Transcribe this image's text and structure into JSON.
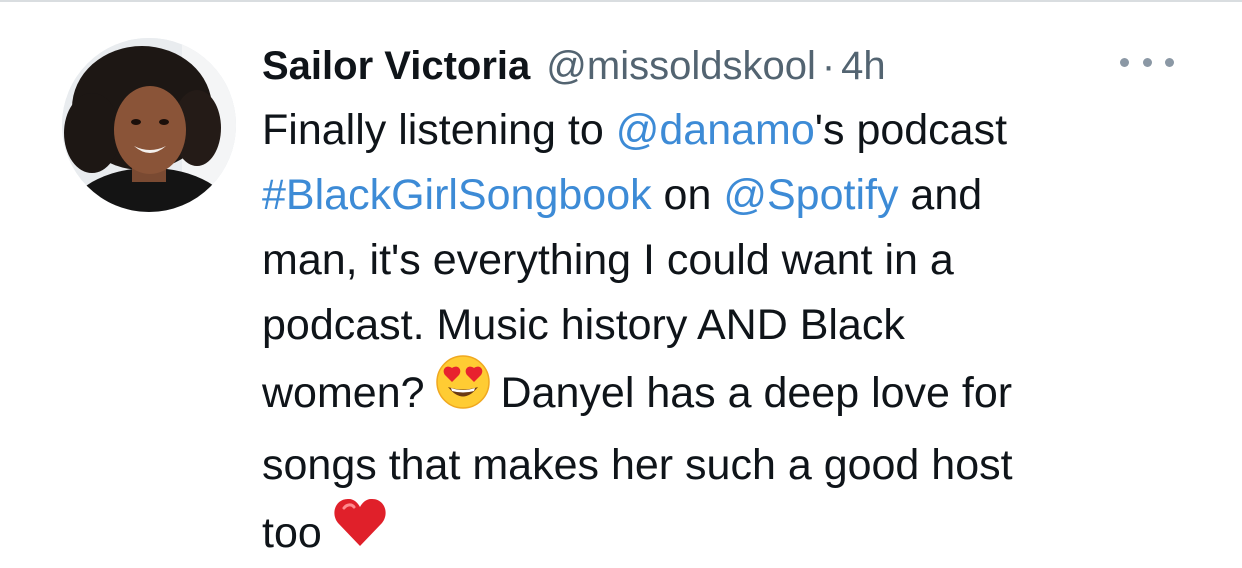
{
  "tweet": {
    "author": {
      "display_name": "Sailor Victoria",
      "handle": "@missoldskool"
    },
    "separator": "·",
    "time": "4h",
    "more_icon": "ellipsis-horizontal-icon",
    "text": {
      "line1": {
        "a": "Finally listening to ",
        "mention": "@danamo",
        "b": "'s podcast"
      },
      "line2": {
        "hashtag": "#BlackGirlSongbook",
        "a": " on ",
        "mention": "@Spotify",
        "b": " and"
      },
      "line3": "man, it's everything I could want in a",
      "line4": "podcast. Music history AND Black",
      "line5": {
        "a": "women?",
        "emoji": "heart-eyes-emoji",
        "b": "Danyel has a deep love for"
      },
      "line6": "songs that makes her such a good host",
      "line7": {
        "a": "too",
        "emoji": "red-heart-emoji"
      }
    },
    "colors": {
      "link": "#3d8bd6",
      "text": "#0f1419",
      "secondary": "#536471"
    }
  }
}
